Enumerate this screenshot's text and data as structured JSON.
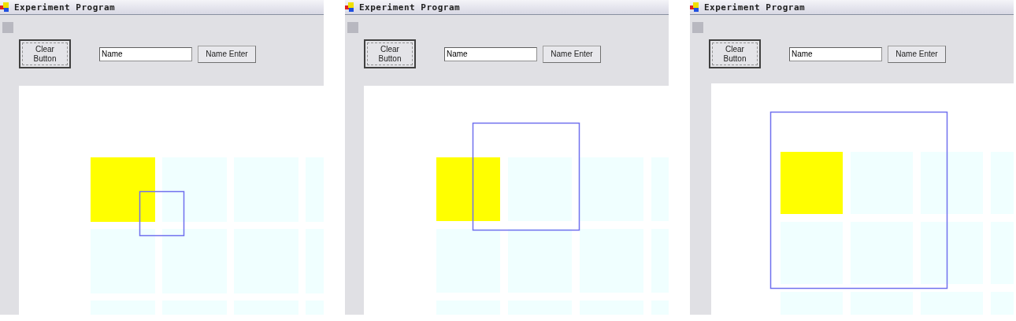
{
  "windows": [
    {
      "title": "Experiment Program",
      "clear_button": "Clear\nButton",
      "name_field": {
        "value": "Name"
      },
      "enter_button": "Name Enter",
      "tiles": [
        [
          {
            "highlighted": true
          },
          {
            "highlighted": false
          },
          {
            "highlighted": false
          },
          {
            "highlighted": false
          }
        ],
        [
          {
            "highlighted": false
          },
          {
            "highlighted": false
          },
          {
            "highlighted": false
          },
          {
            "highlighted": false
          }
        ],
        [
          {
            "highlighted": false
          },
          {
            "highlighted": false
          },
          {
            "highlighted": false
          },
          {
            "highlighted": false
          }
        ]
      ]
    },
    {
      "title": "Experiment Program",
      "clear_button": "Clear\nButton",
      "name_field": {
        "value": "Name"
      },
      "enter_button": "Name Enter",
      "tiles": [
        [
          {
            "highlighted": true
          },
          {
            "highlighted": false
          },
          {
            "highlighted": false
          },
          {
            "highlighted": false
          }
        ],
        [
          {
            "highlighted": false
          },
          {
            "highlighted": false
          },
          {
            "highlighted": false
          },
          {
            "highlighted": false
          }
        ],
        [
          {
            "highlighted": false
          },
          {
            "highlighted": false
          },
          {
            "highlighted": false
          },
          {
            "highlighted": false
          }
        ]
      ]
    },
    {
      "title": "Experiment Program",
      "clear_button": "Clear\nButton",
      "name_field": {
        "value": "Name"
      },
      "enter_button": "Name Enter",
      "tiles": [
        [
          {
            "highlighted": true
          },
          {
            "highlighted": false
          },
          {
            "highlighted": false
          },
          {
            "highlighted": false
          }
        ],
        [
          {
            "highlighted": false
          },
          {
            "highlighted": false
          },
          {
            "highlighted": false
          },
          {
            "highlighted": false
          }
        ],
        [
          {
            "highlighted": false
          },
          {
            "highlighted": false
          },
          {
            "highlighted": false
          },
          {
            "highlighted": false
          }
        ]
      ]
    }
  ]
}
